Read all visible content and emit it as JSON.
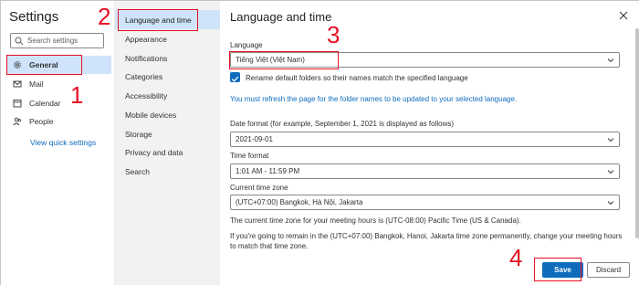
{
  "left_nav": {
    "title": "Settings",
    "search_placeholder": "Search settings",
    "items": [
      {
        "label": "General",
        "icon": "gear-icon",
        "active": true
      },
      {
        "label": "Mail",
        "icon": "mail-icon"
      },
      {
        "label": "Calendar",
        "icon": "calendar-icon"
      },
      {
        "label": "People",
        "icon": "people-icon"
      }
    ],
    "quick_settings_link": "View quick settings"
  },
  "middle_nav": {
    "items": [
      {
        "label": "Language and time",
        "active": true
      },
      {
        "label": "Appearance"
      },
      {
        "label": "Notifications"
      },
      {
        "label": "Categories"
      },
      {
        "label": "Accessibility"
      },
      {
        "label": "Mobile devices"
      },
      {
        "label": "Storage"
      },
      {
        "label": "Privacy and data"
      },
      {
        "label": "Search"
      }
    ]
  },
  "main": {
    "title": "Language and time",
    "language_label": "Language",
    "language_value": "Tiếng Việt (Việt Nam)",
    "rename_folders_label": "Rename default folders so their names match the specified language",
    "refresh_note": "You must refresh the page for the folder names to be updated to your selected language.",
    "date_format_label": "Date format (for example, September 1, 2021 is displayed as follows)",
    "date_format_value": "2021-09-01",
    "time_format_label": "Time format",
    "time_format_value": "1:01 AM - 11:59 PM",
    "time_zone_label": "Current time zone",
    "time_zone_value": "(UTC+07:00) Bangkok, Hà Nội, Jakarta",
    "meeting_hours_note": "The current time zone for your meeting hours is (UTC-08:00) Pacific Time (US & Canada).",
    "remain_note": "If you're going to remain in the (UTC+07:00) Bangkok, Hanoi, Jakarta time zone permanently, change your meeting hours to match that time zone.",
    "save_label": "Save",
    "discard_label": "Discard"
  },
  "annotations": {
    "n1": "1",
    "n2": "2",
    "n3": "3",
    "n4": "4"
  },
  "colors": {
    "accent": "#0f6cbd",
    "selection": "#cfe4fa",
    "annotation": "#e81123"
  }
}
